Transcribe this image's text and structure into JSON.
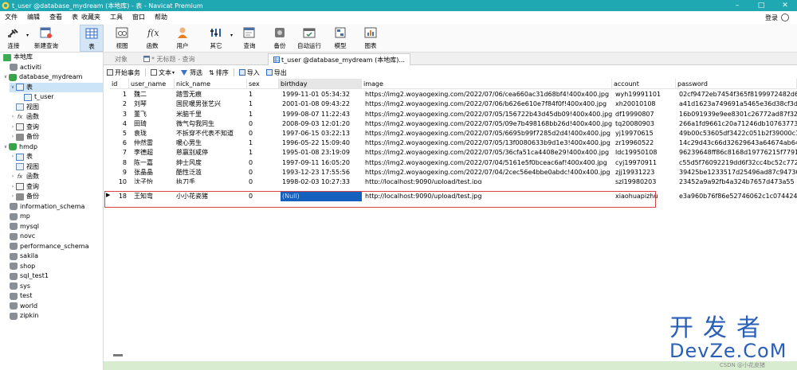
{
  "window": {
    "title": "t_user @database_mydream (本地库) - 表 - Navicat Premium"
  },
  "menubar": {
    "items": [
      "文件",
      "编辑",
      "查看",
      "表",
      "收藏夹",
      "工具",
      "窗口",
      "帮助"
    ],
    "login": "登录"
  },
  "toolbar": {
    "connect": "连接",
    "new_query": "新建查询",
    "table": "表",
    "view": "视图",
    "function": "函数",
    "user": "用户",
    "other": "其它",
    "query": "查询",
    "backup": "备份",
    "automation": "自动运行",
    "model": "模型",
    "chart": "图表"
  },
  "sidebar": {
    "items": [
      {
        "label": "本地库"
      },
      {
        "label": "activiti"
      },
      {
        "label": "database_mydream"
      },
      {
        "label": "表"
      },
      {
        "label": "t_user"
      },
      {
        "label": "视图"
      },
      {
        "label": "函数"
      },
      {
        "label": "查询"
      },
      {
        "label": "备份"
      },
      {
        "label": "hmdp"
      },
      {
        "label": "表"
      },
      {
        "label": "视图"
      },
      {
        "label": "函数"
      },
      {
        "label": "查询"
      },
      {
        "label": "备份"
      },
      {
        "label": "information_schema"
      },
      {
        "label": "mp"
      },
      {
        "label": "mysql"
      },
      {
        "label": "novc"
      },
      {
        "label": "performance_schema"
      },
      {
        "label": "sakila"
      },
      {
        "label": "shop"
      },
      {
        "label": "sql_test1"
      },
      {
        "label": "sys"
      },
      {
        "label": "test"
      },
      {
        "label": "world"
      },
      {
        "label": "zipkin"
      }
    ]
  },
  "tabs": [
    {
      "label": "对象"
    },
    {
      "label": "* 无标题 - 查询"
    },
    {
      "label": "t_user @database_mydream (本地库)..."
    }
  ],
  "subtoolbar": {
    "begin_transaction": "开始事务",
    "text": "文本",
    "filter": "筛选",
    "sort": "排序",
    "import": "导入",
    "export": "导出"
  },
  "grid": {
    "columns": [
      "id",
      "user_name",
      "nick_name",
      "sex",
      "birthday",
      "image",
      "account",
      "password"
    ],
    "rows": [
      [
        "1",
        "魏二",
        "踏雪无痕",
        "1",
        "1999-11-01 05:34:32",
        "https://img2.woyaogexing.com/2022/07/06/cea660ac31d68bf4!400x400.jpg",
        "wyh19991101",
        "02cf9472eb7454f365f8199972482d6"
      ],
      [
        "2",
        "刘琴",
        "国民暖男张艺兴",
        "1",
        "2001-01-08 09:43:22",
        "https://img2.woyaogexing.com/2022/07/06/b626e610e7f84f0f!400x400.jpg",
        "xh20010108",
        "a41d1623a749691a5465e36d38cf3d"
      ],
      [
        "3",
        "董飞",
        "米脑千里",
        "1",
        "1999-08-07 11:22:43",
        "https://img2.woyaogexing.com/2022/07/05/156722b43d45db09!400x400.jpg",
        "df19990807",
        "16b091939e9ee8301c26772ad87f32"
      ],
      [
        "4",
        "田琦",
        "微气勾我同生",
        "0",
        "2008-09-03 12:01:20",
        "https://img2.woyaogexing.com/2022/07/05/09e7b498168bb26d!400x400.jpg",
        "tq20080903",
        "266a1fd9661c20a71246db10763773"
      ],
      [
        "5",
        "袁珑",
        "不拆穿不代表不知道",
        "0",
        "1997-06-15 03:22:13",
        "https://img2.woyaogexing.com/2022/07/05/6695b99f7285d2d4!400x400.jpg",
        "yj19970615",
        "49b00c53605df3422c051b2f39000c1"
      ],
      [
        "6",
        "仲然雷",
        "暖心男生",
        "1",
        "1996-05-22 15:09:40",
        "https://img2.woyaogexing.com/2022/07/05/13f0080633b9d1e3!400x400.jpg",
        "zr19960522",
        "14c29d43c66d32629643a64674ab64"
      ],
      [
        "7",
        "李德超",
        "慈赢别咸停",
        "1",
        "1995-01-08 23:19:09",
        "https://img2.woyaogexing.com/2022/07/05/36cfa51ca4408e29!400x400.jpg",
        "ldc19950108",
        "96239648ff86c8168d19776215f7791"
      ],
      [
        "8",
        "陈一嘉",
        "绅士风度",
        "0",
        "1997-09-11 16:05:20",
        "https://img2.woyaogexing.com/2022/07/04/5161e5f0bceac6af!400x400.jpg",
        "cyj19970911",
        "c55d5f76092219dd6f32cc4bc52c772"
      ],
      [
        "9",
        "张晶晶",
        "酷性泛滥",
        "0",
        "1993-12-23 17:55:56",
        "https://img2.woyaogexing.com/2022/07/04/2cec56e4bbe0abdc!400x400.jpg",
        "zjj19931223",
        "39425be1233517d25496ad87c94730"
      ],
      [
        "10",
        "沈子怡",
        "执刀手",
        "0",
        "1998-02-03 10:27:33",
        "http://localhost:9090/upload/test.jpg",
        "szl19980203",
        "23452a9a92fb4a324b7657d473a55"
      ],
      [
        "18",
        "王知弯",
        "小小花瓷猪",
        "0",
        "(Null)",
        "http://localhost:9090/upload/test.jpg",
        "xiaohuapizhu",
        "e3a960b76f86e52746062c1c074424"
      ]
    ]
  },
  "statusbar": {
    "credit": "CSDN @小花皮猪"
  },
  "watermark": {
    "cn": "开发者",
    "en": "DevZe.CoM"
  }
}
